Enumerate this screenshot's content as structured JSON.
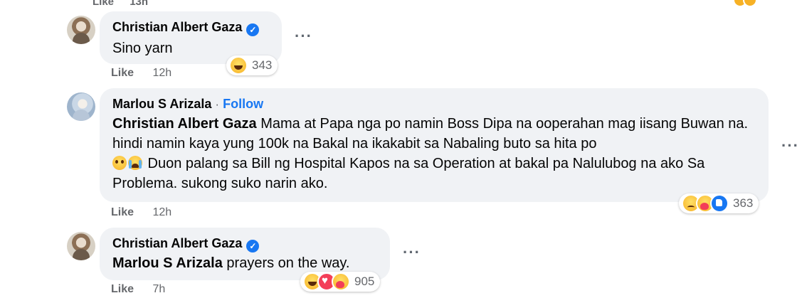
{
  "top_partial": {
    "like_label": "Like",
    "time": "13h"
  },
  "comments": [
    {
      "author": "Christian Albert Gaza",
      "verified": true,
      "text": "Sino yarn",
      "like_label": "Like",
      "time": "12h",
      "reactions": [
        "haha-icon"
      ],
      "reaction_count": "343"
    },
    {
      "author": "Marlou S Arizala",
      "separator": "·",
      "follow_label": "Follow",
      "mention": "Christian Albert Gaza",
      "text_part1": " Mama at Papa nga po namin Boss Dipa na ooperahan mag iisang Buwan na. hindi namin kaya yung 100k na Bakal na ikakabit sa Nabaling buto sa hita po",
      "text_part2": " Duon palang sa Bill ng Hospital Kapos na sa Operation at bakal pa Nalulubog na ako Sa Problema. sukong suko narin ako.",
      "inline_emojis": [
        "pleading-face-icon",
        "crying-face-icon"
      ],
      "like_label": "Like",
      "time": "12h",
      "reactions": [
        "sad-icon",
        "care-icon",
        "like-icon"
      ],
      "reaction_count": "363"
    },
    {
      "author": "Christian Albert Gaza",
      "verified": true,
      "mention": "Marlou S Arizala",
      "text": " prayers on the way.",
      "like_label": "Like",
      "time": "7h",
      "reactions": [
        "haha-icon",
        "love-icon",
        "care-icon"
      ],
      "reaction_count": "905"
    }
  ],
  "more_label": "···",
  "colors": {
    "accent": "#1877f2",
    "bubble": "#f0f2f5",
    "meta": "#65676b"
  }
}
